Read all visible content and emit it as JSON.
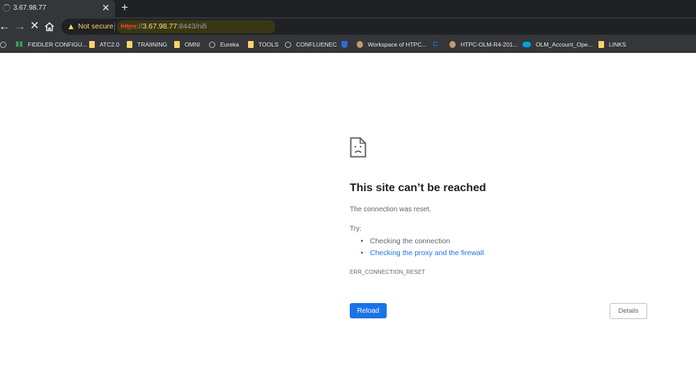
{
  "tab": {
    "title": "3.67.98.77",
    "close_glyph": "✕",
    "new_tab_glyph": "+"
  },
  "toolbar": {
    "back_glyph": "←",
    "forward_glyph": "→",
    "stop_glyph": "✕",
    "home_glyph": "⌂",
    "warning_glyph": "▲",
    "security_label": "Not secure",
    "url_scheme": "https",
    "url_separator": "://",
    "url_host": "3.67.98.77",
    "url_rest": ":8443/nifi"
  },
  "bookmarks": [
    {
      "label": "",
      "icon": "globe-icon"
    },
    {
      "label": "FIDDLER CONFIGU...",
      "icon": "bars-icon"
    },
    {
      "label": "ATC2.0",
      "icon": "folder-icon"
    },
    {
      "label": "TRAIINING",
      "icon": "folder-icon"
    },
    {
      "label": "OMNI",
      "icon": "folder-icon"
    },
    {
      "label": "Eureka",
      "icon": "globe-icon"
    },
    {
      "label": "TOOLS",
      "icon": "folder-icon"
    },
    {
      "label": "CONFLUENEC",
      "icon": "globe-icon"
    },
    {
      "label": "",
      "icon": "shield-icon"
    },
    {
      "label": "Workspace of HTPC...",
      "icon": "face-icon"
    },
    {
      "label": "",
      "icon": "bracket-icon"
    },
    {
      "label": "HTPC-OLM-R4-201...",
      "icon": "face-icon"
    },
    {
      "label": "OLM_Account_Ope...",
      "icon": "cloud-icon"
    },
    {
      "label": "LINKS",
      "icon": "folder-icon"
    }
  ],
  "error": {
    "title": "This site can’t be reached",
    "description": "The connection was reset.",
    "try_label": "Try:",
    "suggestions": [
      "Checking the connection",
      "Checking the proxy and the firewall"
    ],
    "code": "ERR_CONNECTION_RESET",
    "reload_label": "Reload",
    "details_label": "Details"
  },
  "colors": {
    "tab_bar": "#202124",
    "toolbar": "#35363a",
    "warning": "#fdd663",
    "link": "#1a73e8",
    "primary_button": "#1a73e8"
  }
}
